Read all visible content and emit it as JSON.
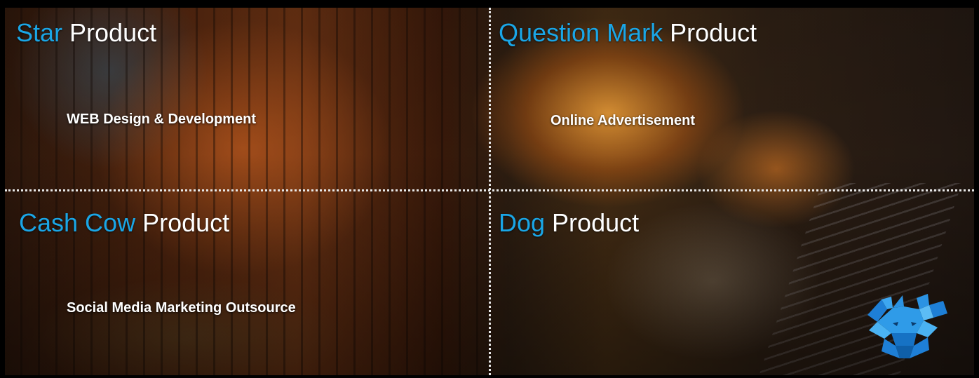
{
  "quadrants": [
    {
      "accent": "Star",
      "suffix": " Product",
      "item": "WEB Design & Development"
    },
    {
      "accent": "Question Mark",
      "suffix": " Product",
      "item": "Online Advertisement"
    },
    {
      "accent": "Cash Cow",
      "suffix": " Product",
      "item": "Social Media Marketing Outsource"
    },
    {
      "accent": "Dog",
      "suffix": " Product",
      "item": ""
    }
  ],
  "colors": {
    "accent": "#1aa6e6",
    "text": "#ffffff",
    "divider": "#e8e8e8"
  },
  "logo": {
    "icon": "moose-logo-icon"
  }
}
